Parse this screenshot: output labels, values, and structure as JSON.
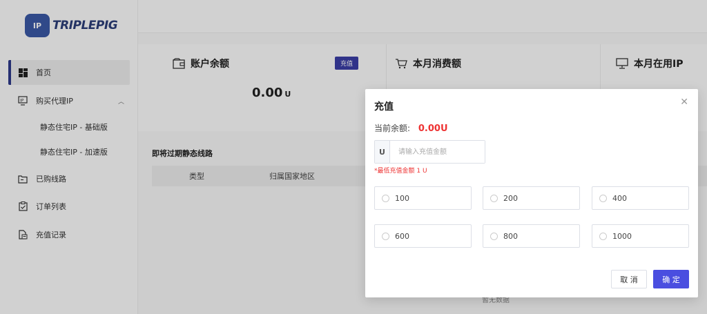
{
  "brand": {
    "logo_text": "TRIPLEPIG",
    "logo_mark": "IP"
  },
  "sidebar": {
    "items": [
      {
        "label": "首页",
        "icon": "dashboard-icon"
      },
      {
        "label": "购买代理IP",
        "icon": "ip-icon"
      },
      {
        "label": "已购线路",
        "icon": "folder-icon"
      },
      {
        "label": "订单列表",
        "icon": "order-icon"
      },
      {
        "label": "充值记录",
        "icon": "record-icon"
      }
    ],
    "sub_items": [
      "静态住宅IP - 基础版",
      "静态住宅IP - 加速版"
    ]
  },
  "cards": {
    "balance": {
      "title": "账户余额",
      "badge": "充值",
      "value": "0.00",
      "unit": "U"
    },
    "monthly_spend": {
      "title": "本月消费额"
    },
    "monthly_ip": {
      "title": "本月在用IP"
    }
  },
  "expiring": {
    "title": "即将过期静态线路",
    "columns": [
      "类型",
      "归属国家地区"
    ],
    "empty_text": "暂无数据"
  },
  "modal": {
    "title": "充值",
    "balance_label": "当前余额:",
    "balance_value": "0.00U",
    "currency_prefix": "U",
    "amount_placeholder": "请输入充值金额",
    "min_hint": "*最低充值金额 1 U",
    "options": [
      "100",
      "200",
      "400",
      "600",
      "800",
      "1000"
    ],
    "cancel_label": "取 消",
    "confirm_label": "确 定"
  },
  "colors": {
    "accent": "#4a4ee0",
    "danger": "#e33333",
    "brand": "#2d3f7a"
  }
}
